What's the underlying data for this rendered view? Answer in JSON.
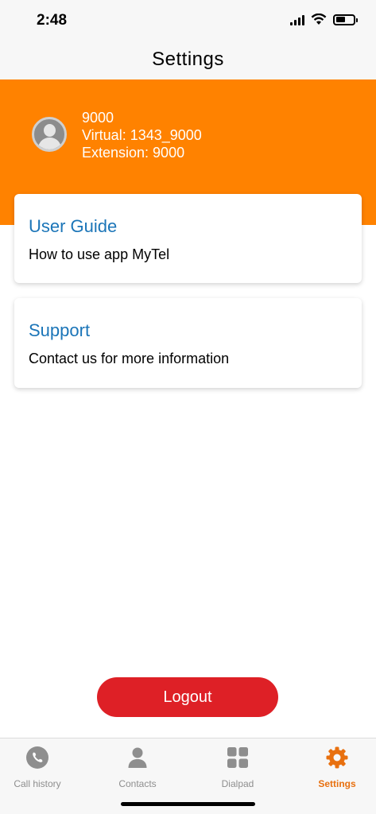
{
  "status_bar": {
    "time": "2:48"
  },
  "header": {
    "title": "Settings"
  },
  "profile": {
    "number": "9000",
    "virtual": "Virtual: 1343_9000",
    "extension": "Extension: 9000"
  },
  "cards": {
    "user_guide": {
      "title": "User Guide",
      "description": "How to use app MyTel"
    },
    "support": {
      "title": "Support",
      "description": "Contact us for more information"
    }
  },
  "logout": {
    "label": "Logout"
  },
  "tabs": [
    {
      "label": "Call history",
      "icon": "phone-icon"
    },
    {
      "label": "Contacts",
      "icon": "person-icon"
    },
    {
      "label": "Dialpad",
      "icon": "grid-icon"
    },
    {
      "label": "Settings",
      "icon": "gear-icon",
      "active": true
    }
  ],
  "colors": {
    "accent": "#ff8200",
    "link_blue": "#1b75b8",
    "logout_red": "#de2026",
    "active_tab": "#e8700f"
  }
}
